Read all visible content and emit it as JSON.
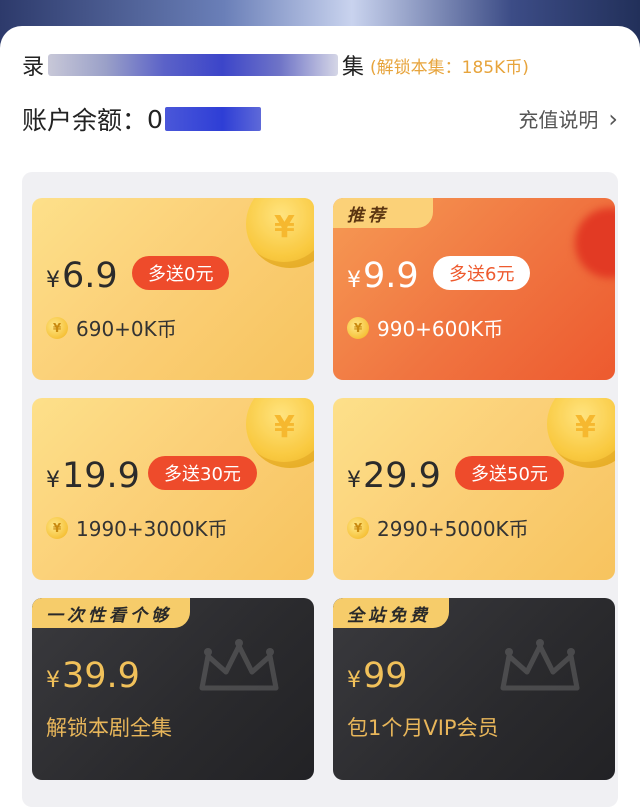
{
  "header": {
    "title_first_char": "录",
    "title_last_char": "集",
    "unlock_note": "(解锁本集：185K币)",
    "balance_label": "账户余额：",
    "balance_value": "0",
    "recharge_link": "充值说明"
  },
  "cards": [
    {
      "yen": "¥",
      "price": "6.9",
      "bonus": "多送0元",
      "coins": "690+0K币",
      "coin_glyph": "¥"
    },
    {
      "ribbon": "推荐",
      "yen": "¥",
      "price": "9.9",
      "bonus": "多送6元",
      "coins": "990+600K币",
      "coin_glyph": "¥"
    },
    {
      "yen": "¥",
      "price": "19.9",
      "bonus": "多送30元",
      "coins": "1990+3000K币",
      "coin_glyph": "¥"
    },
    {
      "yen": "¥",
      "price": "29.9",
      "bonus": "多送50元",
      "coins": "2990+5000K币",
      "coin_glyph": "¥"
    },
    {
      "ribbon": "一次性看个够",
      "yen": "¥",
      "price": "39.9",
      "desc": "解锁本剧全集"
    },
    {
      "ribbon": "全站免费",
      "yen": "¥",
      "price": "99",
      "desc": "包1个月VIP会员"
    }
  ],
  "colors": {
    "gold_card": "#fbd078",
    "recommended_card": "#f07440",
    "dark_card": "#2a2a2d",
    "bonus_badge": "#ee4b2b",
    "accent_text": "#e7a43c"
  }
}
